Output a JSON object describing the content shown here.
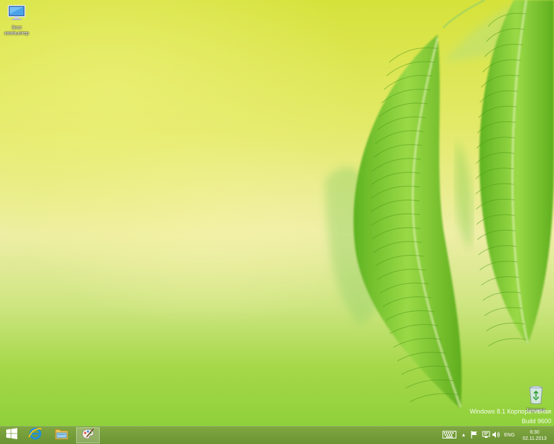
{
  "desktop": {
    "icons": [
      {
        "label": "Этот компьютер",
        "icon": "computer-icon"
      },
      {
        "label": "Корзина",
        "icon": "recycle-bin-icon"
      }
    ],
    "watermark": {
      "line1": "Windows 8.1 Корпоративная",
      "line2": "Build 9600"
    }
  },
  "taskbar": {
    "pinned": [
      {
        "icon": "windows-logo-icon",
        "name": "Start"
      },
      {
        "icon": "internet-explorer-icon"
      },
      {
        "icon": "file-explorer-icon"
      },
      {
        "icon": "paint-icon",
        "active": true
      }
    ],
    "tray": {
      "icons": [
        "keyboard-icon",
        "show-hidden-icons-arrow",
        "action-center-flag-icon",
        "network-icon",
        "volume-icon"
      ],
      "language": "ENG",
      "time": "6:30",
      "date": "02.11.2013"
    }
  },
  "colors": {
    "taskbar": "#739c38",
    "leaf": "#7fc92e",
    "wallpaper_top": "#d5e23a",
    "wallpaper_bottom": "#8fd03a"
  }
}
